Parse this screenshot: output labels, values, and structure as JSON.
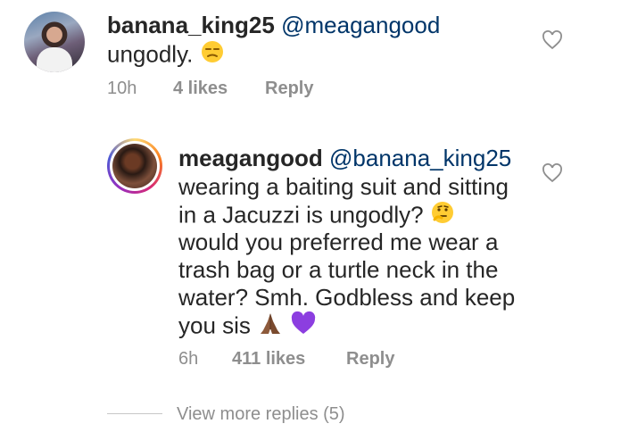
{
  "comment": {
    "username": "banana_king25",
    "mention": "@meagangood",
    "text": "ungodly.",
    "emoji": "unamused-face-icon",
    "time": "10h",
    "likes": "4 likes",
    "reply_label": "Reply"
  },
  "reply": {
    "username": "meagangood",
    "mention": "@banana_king25",
    "text_line1": "wearing a baiting suit and sitting",
    "text_line2": "in a Jacuzzi is ungodly?",
    "text_line3": "would you preferred me wear a",
    "text_line4": "trash bag or a turtle neck in the",
    "text_line5": "water? Smh. Godbless and keep",
    "text_line6": "you sis",
    "time": "6h",
    "likes": "411 likes",
    "reply_label": "Reply"
  },
  "view_more": "View more replies (5)",
  "colors": {
    "text": "#262626",
    "mention": "#003569",
    "meta": "#8e8e8e"
  }
}
